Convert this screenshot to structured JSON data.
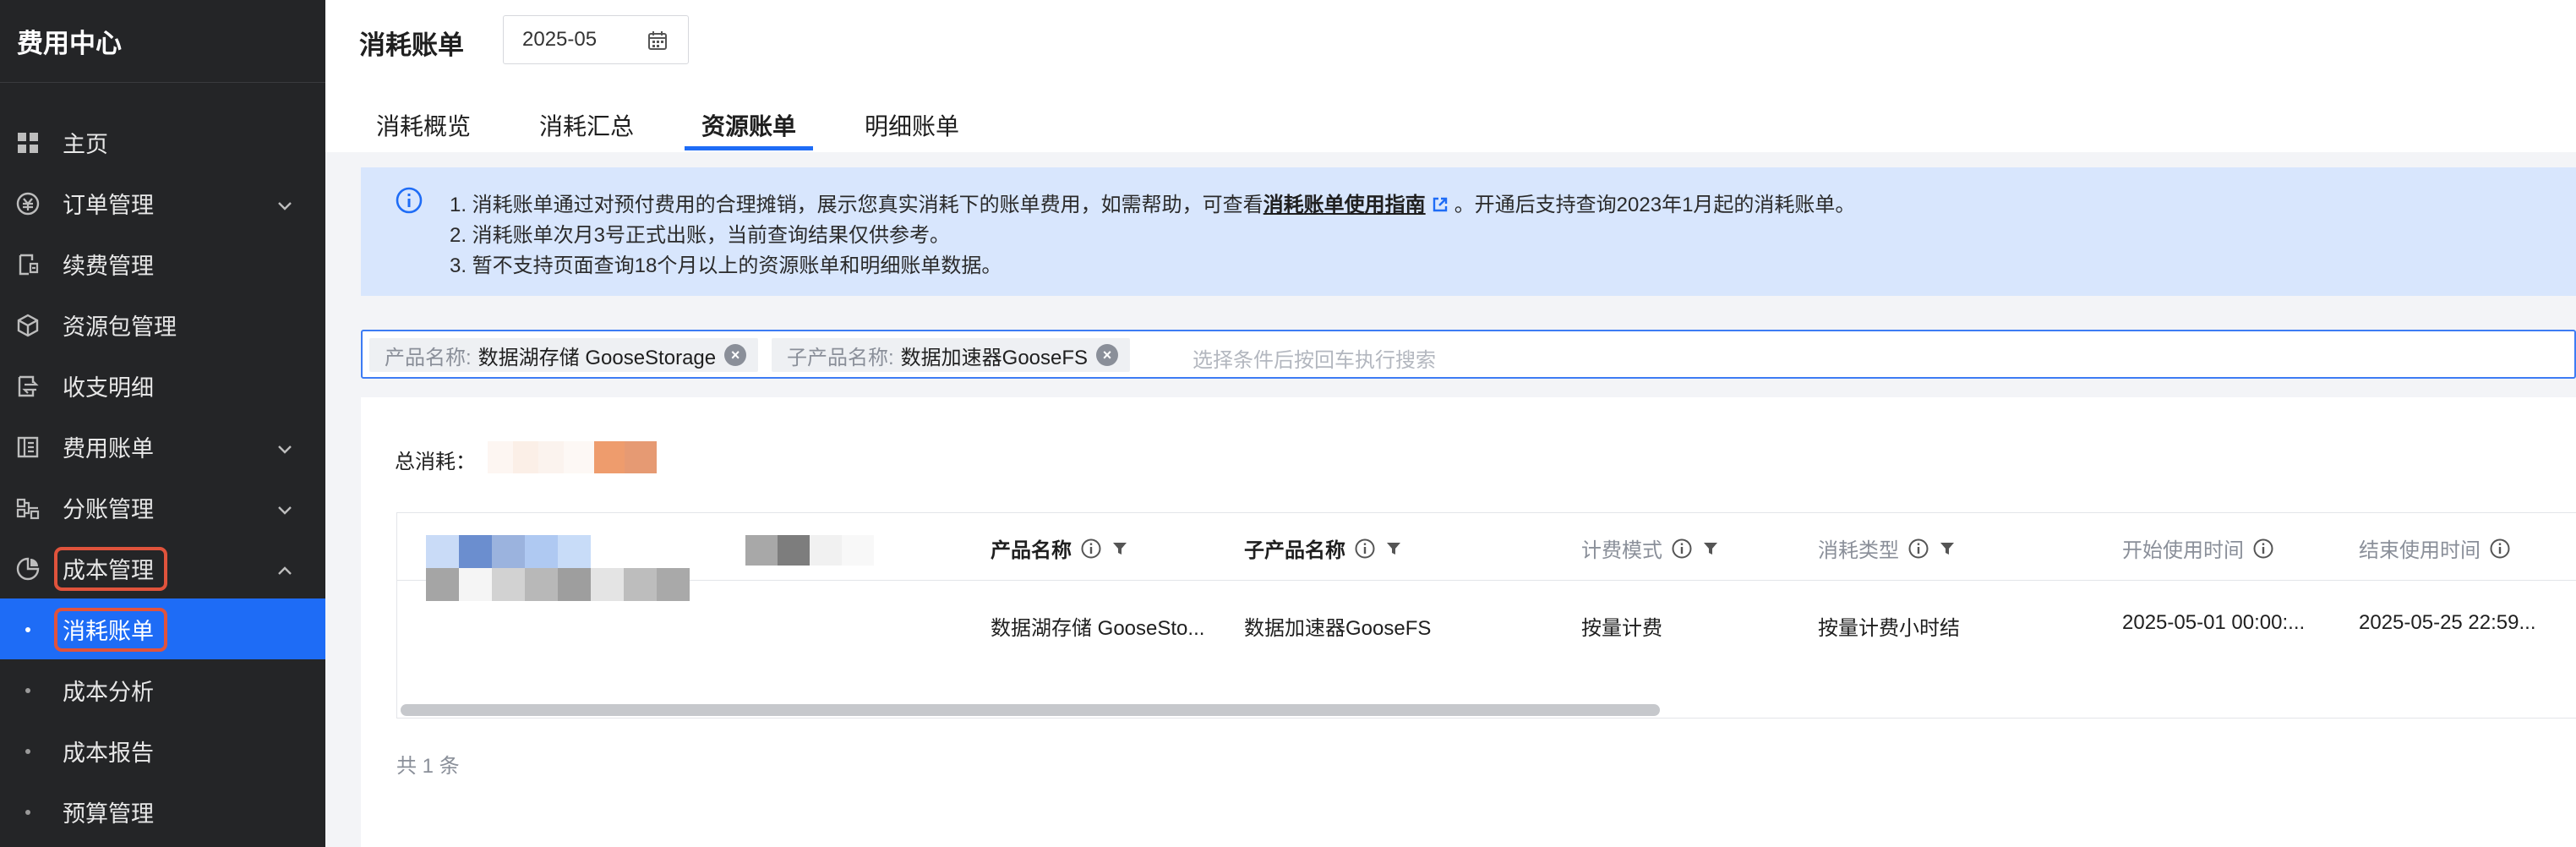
{
  "sidebar": {
    "title": "费用中心",
    "items": [
      {
        "label": "主页",
        "icon": "grid-icon",
        "chevron": ""
      },
      {
        "label": "订单管理",
        "icon": "coin-icon",
        "chevron": "down"
      },
      {
        "label": "续费管理",
        "icon": "renew-icon",
        "chevron": ""
      },
      {
        "label": "资源包管理",
        "icon": "package-icon",
        "chevron": ""
      },
      {
        "label": "收支明细",
        "icon": "transfer-icon",
        "chevron": ""
      },
      {
        "label": "费用账单",
        "icon": "bill-icon",
        "chevron": "down"
      },
      {
        "label": "分账管理",
        "icon": "split-icon",
        "chevron": "down"
      },
      {
        "label": "成本管理",
        "icon": "pie-icon",
        "chevron": "up"
      }
    ],
    "sub_items": [
      {
        "label": "消耗账单",
        "active": true
      },
      {
        "label": "成本分析",
        "active": false
      },
      {
        "label": "成本报告",
        "active": false
      },
      {
        "label": "预算管理",
        "active": false
      }
    ],
    "highlight_color": "#e0533c",
    "active_color": "#1e6cf6"
  },
  "header": {
    "title": "消耗账单",
    "month": "2025-05"
  },
  "tabs": [
    {
      "label": "消耗概览",
      "active": false
    },
    {
      "label": "消耗汇总",
      "active": false
    },
    {
      "label": "资源账单",
      "active": true
    },
    {
      "label": "明细账单",
      "active": false
    }
  ],
  "notice": {
    "line1_prefix": "1. 消耗账单通过对预付费用的合理摊销，展示您真实消耗下的账单费用，如需帮助，可查看",
    "line1_link": "消耗账单使用指南",
    "line1_suffix": "。开通后支持查询2023年1月起的消耗账单。",
    "line2": "2. 消耗账单次月3号正式出账，当前查询结果仅供参考。",
    "line3": "3. 暂不支持页面查询18个月以上的资源账单和明细账单数据。"
  },
  "filter": {
    "tags": [
      {
        "key": "产品名称:",
        "value": "数据湖存储 GooseStorage"
      },
      {
        "key": "子产品名称:",
        "value": "数据加速器GooseFS"
      }
    ],
    "placeholder": "选择条件后按回车执行搜索"
  },
  "summary": {
    "total_label": "总消耗："
  },
  "table": {
    "columns": [
      {
        "label": "资源ID/实例别名",
        "info": true,
        "filter": true,
        "bold": false
      },
      {
        "label": "支付者UIN",
        "info": true,
        "filter": false,
        "bold": false
      },
      {
        "label": "产品名称",
        "info": true,
        "filter": true,
        "bold": true
      },
      {
        "label": "子产品名称",
        "info": true,
        "filter": true,
        "bold": true
      },
      {
        "label": "计费模式",
        "info": true,
        "filter": true,
        "bold": false
      },
      {
        "label": "消耗类型",
        "info": true,
        "filter": true,
        "bold": false
      },
      {
        "label": "开始使用时间",
        "info": true,
        "filter": false,
        "bold": false
      },
      {
        "label": "结束使用时间",
        "info": true,
        "filter": false,
        "bold": false
      }
    ],
    "rows": [
      {
        "product": "数据湖存储 GooseSto...",
        "sub_product": "数据加速器GooseFS",
        "billing_mode": "按量计费",
        "consume_type": "按量计费小时结",
        "start_time": "2025-05-01 00:00:...",
        "end_time": "2025-05-25 22:59..."
      }
    ],
    "total_count": "共 1 条"
  }
}
